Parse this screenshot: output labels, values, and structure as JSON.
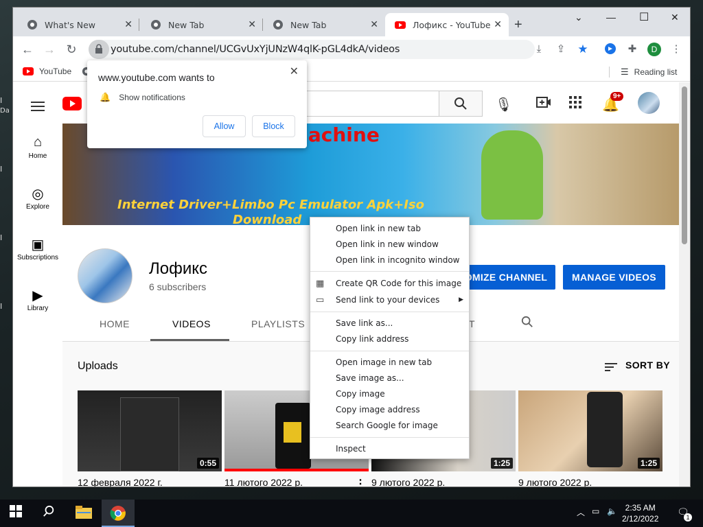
{
  "desktop": {
    "labels": [
      "I",
      "Da",
      "I",
      "I",
      "I"
    ]
  },
  "tabs": [
    {
      "title": "What's New",
      "active": false
    },
    {
      "title": "New Tab",
      "active": false
    },
    {
      "title": "New Tab",
      "active": false
    },
    {
      "title": "Лофикс - YouTube",
      "active": true
    }
  ],
  "toolbar": {
    "url": "youtube.com/channel/UCGvUxYjUNzW4qlK-pGL4dkA/videos",
    "profile_initial": "D"
  },
  "bookmarks": {
    "youtube": "YouTube",
    "reading_list": "Reading list"
  },
  "notification": {
    "title": "www.youtube.com wants to",
    "permission": "Show notifications",
    "allow": "Allow",
    "block": "Block"
  },
  "youtube": {
    "notif_badge": "9+",
    "guide": [
      {
        "label": "Home",
        "icon": "home-icon"
      },
      {
        "label": "Explore",
        "icon": "compass-icon"
      },
      {
        "label": "Subscriptions",
        "icon": "subscriptions-icon"
      },
      {
        "label": "Library",
        "icon": "library-icon"
      }
    ],
    "banner": {
      "line1": "Machine",
      "line2": "Internet Driver+Limbo Pc Emulator Apk+Iso",
      "line3": "Download"
    },
    "channel": {
      "name": "Лофикс",
      "subscribers": "6 subscribers"
    },
    "buttons": {
      "customize": "OMIZE CHANNEL",
      "manage": "MANAGE VIDEOS"
    },
    "tabs": [
      "HOME",
      "VIDEOS",
      "PLAYLISTS",
      "T"
    ],
    "uploads_label": "Uploads",
    "sort_label": "SORT BY",
    "videos": [
      {
        "date": "12 февраля 2022 г.",
        "duration": "0:55"
      },
      {
        "date": "11 лютого 2022 р.",
        "duration": ""
      },
      {
        "date": "9 лютого 2022 р.",
        "duration": "1:25"
      },
      {
        "date": "9 лютого 2022 р.",
        "duration": "1:25"
      }
    ]
  },
  "context_menu": {
    "open_new_tab": "Open link in new tab",
    "open_new_window": "Open link in new window",
    "open_incognito": "Open link in incognito window",
    "qr_code": "Create QR Code for this image",
    "send_link": "Send link to your devices",
    "save_link": "Save link as...",
    "copy_link": "Copy link address",
    "open_image": "Open image in new tab",
    "save_image": "Save image as...",
    "copy_image": "Copy image",
    "copy_image_address": "Copy image address",
    "search_google": "Search Google for image",
    "inspect": "Inspect"
  },
  "taskbar": {
    "time": "2:35 AM",
    "date": "2/12/2022",
    "notif_count": "1"
  }
}
